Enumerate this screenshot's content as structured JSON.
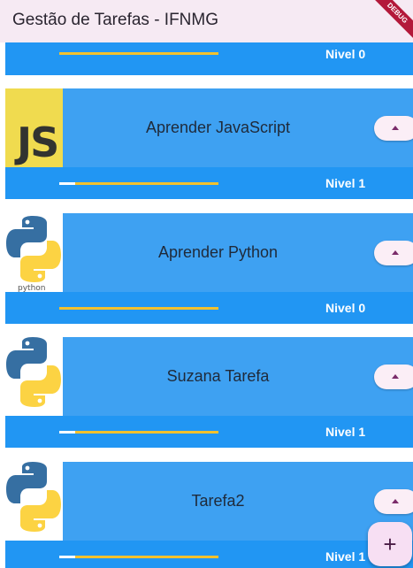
{
  "app_bar": {
    "title": "Gestão de Tarefas - IFNMG",
    "debug_label": "DEBUG"
  },
  "partial_card": {
    "level_label": "Nivel 0",
    "progress": 0
  },
  "tasks": [
    {
      "name": "Aprender JavaScript",
      "image": "javascript-logo",
      "level_label": "Nivel 1",
      "progress": 0.1
    },
    {
      "name": "Aprender Python",
      "image": "python-logo",
      "level_label": "Nivel 0",
      "progress": 0
    },
    {
      "name": "Suzana Tarefa",
      "image": "python-logo",
      "level_label": "Nivel 1",
      "progress": 0.1
    },
    {
      "name": "Tarefa2",
      "image": "python-logo",
      "level_label": "Nivel 1",
      "progress": 0.1
    }
  ],
  "js_logo_text": "JS",
  "python_logo_text": "python",
  "icons": {
    "level_up": "arrow-up-icon",
    "fab": "add-icon"
  },
  "fab_label": "+",
  "colors": {
    "app_bar": "#f6eaf3",
    "card": "#2196f3",
    "card_top": "#3ea1f2",
    "progress_track": "#f2c12e",
    "progress_fill": "#ffffff",
    "button": "#fbeef6"
  }
}
